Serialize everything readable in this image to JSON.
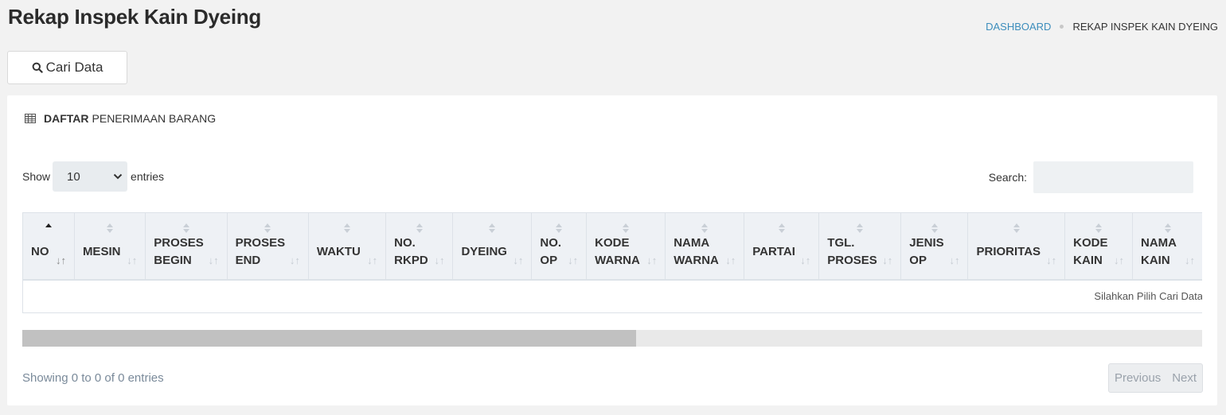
{
  "header": {
    "title": "Rekap Inspek Kain Dyeing",
    "breadcrumb": {
      "link": "DASHBOARD",
      "current": "REKAP INSPEK KAIN DYEING"
    }
  },
  "toolbar": {
    "search_label": "Cari Data",
    "search_icon": "search-icon"
  },
  "card": {
    "title_bold": "DAFTAR",
    "title_rest": "PENERIMAAN BARANG",
    "title_icon": "table-icon"
  },
  "length": {
    "show_label": "Show",
    "value": "10",
    "entries_label": "entries"
  },
  "filter": {
    "search_label": "Search:",
    "value": ""
  },
  "table": {
    "columns": [
      {
        "label": "NO"
      },
      {
        "label": "MESIN"
      },
      {
        "label": "PROSES BEGIN"
      },
      {
        "label": "PROSES END"
      },
      {
        "label": "WAKTU"
      },
      {
        "label": "NO. RKPD"
      },
      {
        "label": "DYEING"
      },
      {
        "label": "NO. OP"
      },
      {
        "label": "KODE WARNA"
      },
      {
        "label": "NAMA WARNA"
      },
      {
        "label": "PARTAI"
      },
      {
        "label": "TGL. PROSES"
      },
      {
        "label": "JENIS OP"
      },
      {
        "label": "PRIORITAS"
      },
      {
        "label": "KODE KAIN"
      },
      {
        "label": "NAMA KAIN"
      }
    ],
    "sorted_column": "NO",
    "empty_message": "Silahkan Pilih Cari Data"
  },
  "scroll": {
    "position_fraction": 0.52
  },
  "footer": {
    "info": "Showing 0 to 0 of 0 entries",
    "prev_label": "Previous",
    "next_label": "Next"
  }
}
